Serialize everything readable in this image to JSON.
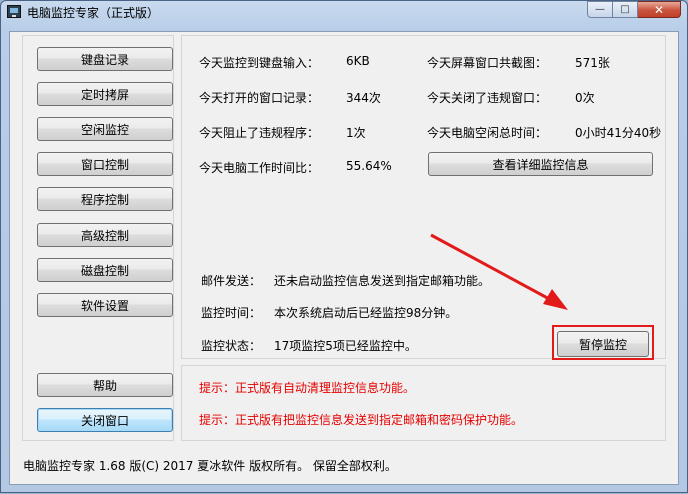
{
  "window": {
    "title": "电脑监控专家（正式版）",
    "controls": {
      "minimize": "—",
      "maximize": "□",
      "close": "✕"
    }
  },
  "sidebar": {
    "items": [
      {
        "label": "键盘记录"
      },
      {
        "label": "定时拷屏"
      },
      {
        "label": "空闲监控"
      },
      {
        "label": "窗口控制"
      },
      {
        "label": "程序控制"
      },
      {
        "label": "高级控制"
      },
      {
        "label": "磁盘控制"
      },
      {
        "label": "软件设置"
      }
    ],
    "help_label": "帮助",
    "close_label": "关闭窗口"
  },
  "stats": {
    "keyboard_label": "今天监控到键盘输入：",
    "keyboard_value": "6KB",
    "screenshots_label": "今天屏幕窗口共截图：",
    "screenshots_value": "571张",
    "windows_opened_label": "今天打开的窗口记录：",
    "windows_opened_value": "344次",
    "violations_closed_label": "今天关闭了违规窗口：",
    "violations_closed_value": "0次",
    "programs_blocked_label": "今天阻止了违规程序：",
    "programs_blocked_value": "1次",
    "idle_time_label": "今天电脑空闲总时间：",
    "idle_time_value": "0小时41分40秒",
    "work_ratio_label": "今天电脑工作时间比：",
    "work_ratio_value": "55.64%",
    "details_button": "查看详细监控信息"
  },
  "status": {
    "mail_label": "邮件发送：",
    "mail_value": "还未启动监控信息发送到指定邮箱功能。",
    "time_label": "监控时间：",
    "time_value": "本次系统启动后已经监控98分钟。",
    "state_label": "监控状态：",
    "state_value": "17项监控5项已经监控中。",
    "pause_button": "暂停监控"
  },
  "tips": {
    "tip1": "提示：正式版有自动清理监控信息功能。",
    "tip2": "提示：正式版有把监控信息发送到指定邮箱和密码保护功能。"
  },
  "footer": "电脑监控专家 1.68 版(C) 2017 夏冰软件 版权所有。 保留全部权利。",
  "colors": {
    "annotation_red": "#e31a1a",
    "tip_red": "#e60000",
    "title_bar": "#b7cde8"
  }
}
